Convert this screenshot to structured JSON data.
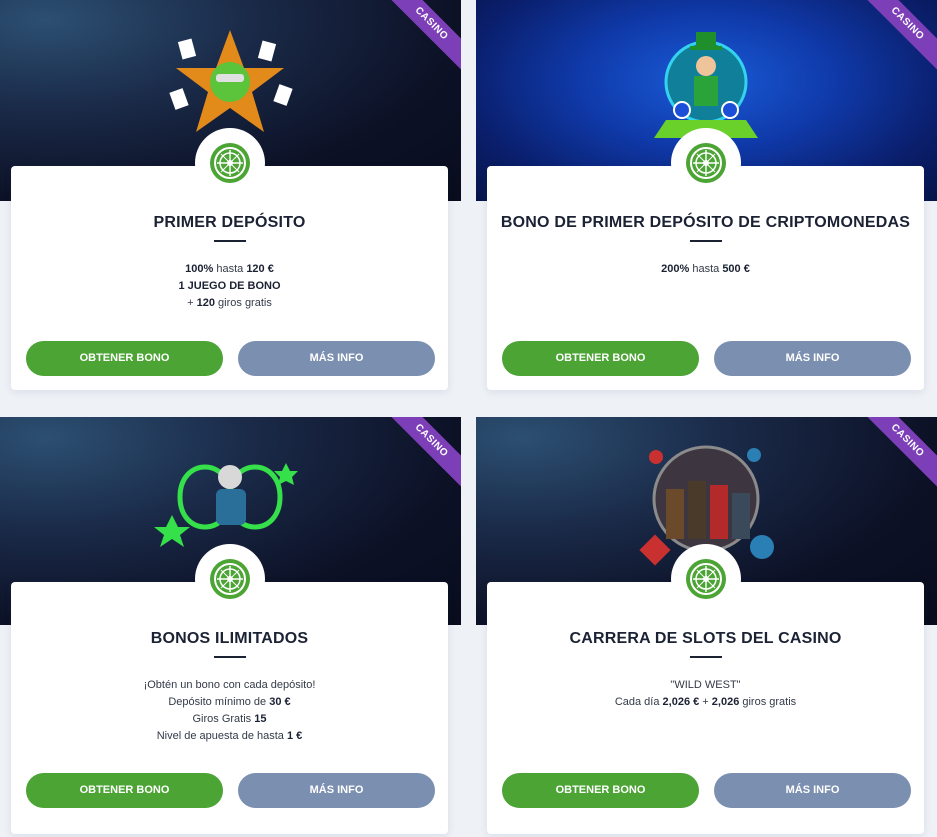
{
  "cards": [
    {
      "ribbon": "CASINO",
      "title": "PRIMER DEPÓSITO",
      "lines": [
        [
          {
            "t": "100%",
            "b": true
          },
          {
            "t": " hasta ",
            "b": false
          },
          {
            "t": "120 €",
            "b": true
          }
        ],
        [
          {
            "t": "1 JUEGO DE BONO",
            "b": true
          }
        ],
        [
          {
            "t": "+ ",
            "b": false
          },
          {
            "t": "120",
            "b": true
          },
          {
            "t": " giros gratis",
            "b": false
          }
        ]
      ],
      "btn_primary": "OBTENER BONO",
      "btn_secondary": "MÁS INFO",
      "icon": "roulette-icon",
      "art": "frog-cards-icon"
    },
    {
      "ribbon": "CASINO",
      "title": "BONO DE PRIMER DEPÓSITO DE CRIPTOMONEDAS",
      "lines": [
        [
          {
            "t": "200%",
            "b": true
          },
          {
            "t": " hasta ",
            "b": false
          },
          {
            "t": "500 €",
            "b": true
          }
        ]
      ],
      "btn_primary": "OBTENER BONO",
      "btn_secondary": "MÁS INFO",
      "icon": "roulette-icon",
      "art": "leprechaun-crypto-icon"
    },
    {
      "ribbon": "CASINO",
      "title": "BONOS ILIMITADOS",
      "lines": [
        [
          {
            "t": "¡Obtén un bono con cada depósito!",
            "b": false
          }
        ],
        [
          {
            "t": "Depósito mínimo de ",
            "b": false
          },
          {
            "t": "30 €",
            "b": true
          }
        ],
        [
          {
            "t": "Giros Gratis ",
            "b": false
          },
          {
            "t": "15",
            "b": true
          }
        ],
        [
          {
            "t": "Nivel de apuesta de hasta ",
            "b": false
          },
          {
            "t": "1 €",
            "b": true
          }
        ]
      ],
      "btn_primary": "OBTENER BONO",
      "btn_secondary": "MÁS INFO",
      "icon": "roulette-icon",
      "art": "scientist-infinity-icon"
    },
    {
      "ribbon": "CASINO",
      "title": "CARRERA DE SLOTS DEL CASINO",
      "lines": [
        [
          {
            "t": "\"WILD WEST\"",
            "b": false
          }
        ],
        [
          {
            "t": "Cada día ",
            "b": false
          },
          {
            "t": "2,026 €",
            "b": true
          },
          {
            "t": " + ",
            "b": false
          },
          {
            "t": "2,026",
            "b": true
          },
          {
            "t": " giros gratis",
            "b": false
          }
        ]
      ],
      "btn_primary": "OBTENER BONO",
      "btn_secondary": "MÁS INFO",
      "icon": "roulette-icon",
      "art": "wild-west-characters-icon"
    }
  ],
  "colors": {
    "accent": "#4ba434",
    "secondary": "#7b8fb0",
    "ribbon": "#7c3fb8",
    "title": "#1b2233"
  }
}
